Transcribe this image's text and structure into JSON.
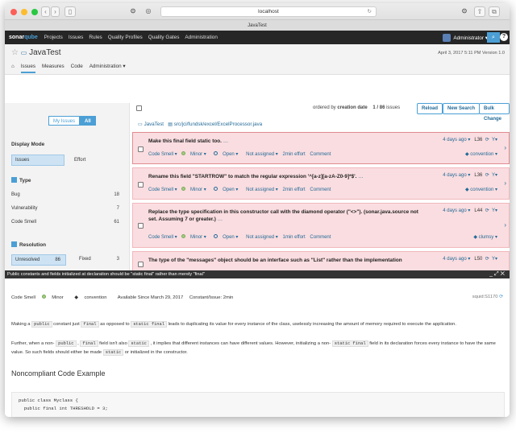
{
  "browser": {
    "url": "localhost",
    "tab_title": "JavaTest"
  },
  "topnav": {
    "logo_a": "sonar",
    "logo_b": "qube",
    "items": [
      "Projects",
      "Issues",
      "Rules",
      "Quality Profiles",
      "Quality Gates",
      "Administration"
    ],
    "user": "Administrator ▾"
  },
  "project": {
    "title": "JavaTest",
    "meta": "April 3, 2017 5:11 PM   Version 1.0",
    "tabs": [
      "Issues",
      "Measures",
      "Code",
      "Administration ▾"
    ]
  },
  "sidebar": {
    "my_issues": "My Issues",
    "all": "All",
    "display_mode": "Display Mode",
    "dm_issues": "Issues",
    "dm_effort": "Effort",
    "type_heading": "Type",
    "types": [
      {
        "label": "Bug",
        "count": "18"
      },
      {
        "label": "Vulnerability",
        "count": "7"
      },
      {
        "label": "Code Smell",
        "count": "61"
      }
    ],
    "resolution_heading": "Resolution",
    "unresolved": "Unresolved",
    "unresolved_count": "86",
    "fixed": "Fixed",
    "fixed_count": "3"
  },
  "toolbar": {
    "ordered_by": "ordered by",
    "order_field": "creation date",
    "count": "1 / 86",
    "count_suffix": "issues",
    "reload": "Reload",
    "new_search": "New Search",
    "bulk_change": "Bulk Change"
  },
  "breadcrumb": {
    "project": "JavaTest",
    "path": "src/jci/fundsk/excel/ExcelProcessor.java"
  },
  "issues": [
    {
      "message": "Make this final field static too.",
      "type": "Code Smell ▾",
      "severity": "Minor ▾",
      "status": "Open ▾",
      "assignee": "Not assigned ▾",
      "effort": "2min effort",
      "comment": "Comment",
      "age": "4 days ago ▾",
      "line": "L36",
      "tag": "convention ▾"
    },
    {
      "message": "Rename this field \"STARTROW\" to match the regular expression '^[a-z][a-zA-Z0-9]*$'.",
      "type": "Code Smell ▾",
      "severity": "Minor ▾",
      "status": "Open ▾",
      "assignee": "Not assigned ▾",
      "effort": "2min effort",
      "comment": "Comment",
      "age": "4 days ago ▾",
      "line": "L36",
      "tag": "convention ▾"
    },
    {
      "message": "Replace the type specification in this constructor call with the diamond operator (\"<>\"). (sonar.java.source not set. Assuming 7 or greater.)",
      "type": "Code Smell ▾",
      "severity": "Minor ▾",
      "status": "Open ▾",
      "assignee": "Not assigned ▾",
      "effort": "1min effort",
      "comment": "Comment",
      "age": "4 days ago ▾",
      "line": "L44",
      "tag": "clumsy ▾"
    },
    {
      "message": "The type of the \"messages\" object should be an interface such as \"List\" rather than the implementation",
      "age": "4 days ago ▾",
      "line": "L50"
    }
  ],
  "panel": {
    "title": "Public constants and fields initialized at declaration should be \"static final\" rather than merely \"final\"",
    "info_type": "Code Smell",
    "info_severity": "Minor",
    "info_tag": "convention",
    "info_available": "Available Since March 29, 2017",
    "info_debt": "Constant/Issue: 2min",
    "rule_key": "squid:S1170",
    "p1_a": "Making a ",
    "p1_code1": "public",
    "p1_b": " constant just ",
    "p1_code2": "final",
    "p1_c": " as opposed to ",
    "p1_code3": "static final",
    "p1_d": " leads to duplicating its value for every instance of the class, uselessly increasing the amount of memory required to execute the application.",
    "p2_a": "Further, when a non- ",
    "p2_code1": "public",
    "p2_b": " , ",
    "p2_code2": "final",
    "p2_c": " field isn't also ",
    "p2_code3": "static",
    "p2_d": " , it implies that different instances can have different values. However, initializing a non- ",
    "p2_code4": "static final",
    "p2_e": " field in its declaration forces every instance to have the same value. So such fields should either be made ",
    "p2_code5": "static",
    "p2_f": " or initialized in the constructor.",
    "noncompliant": "Noncompliant Code Example",
    "code_line1": "public class Myclass {",
    "code_line2": "  public final int THRESHOLD = 3;"
  },
  "colors": {
    "accent": "#4b9fd5",
    "issue_bg": "#fadde0",
    "nav_bg": "#262626"
  }
}
